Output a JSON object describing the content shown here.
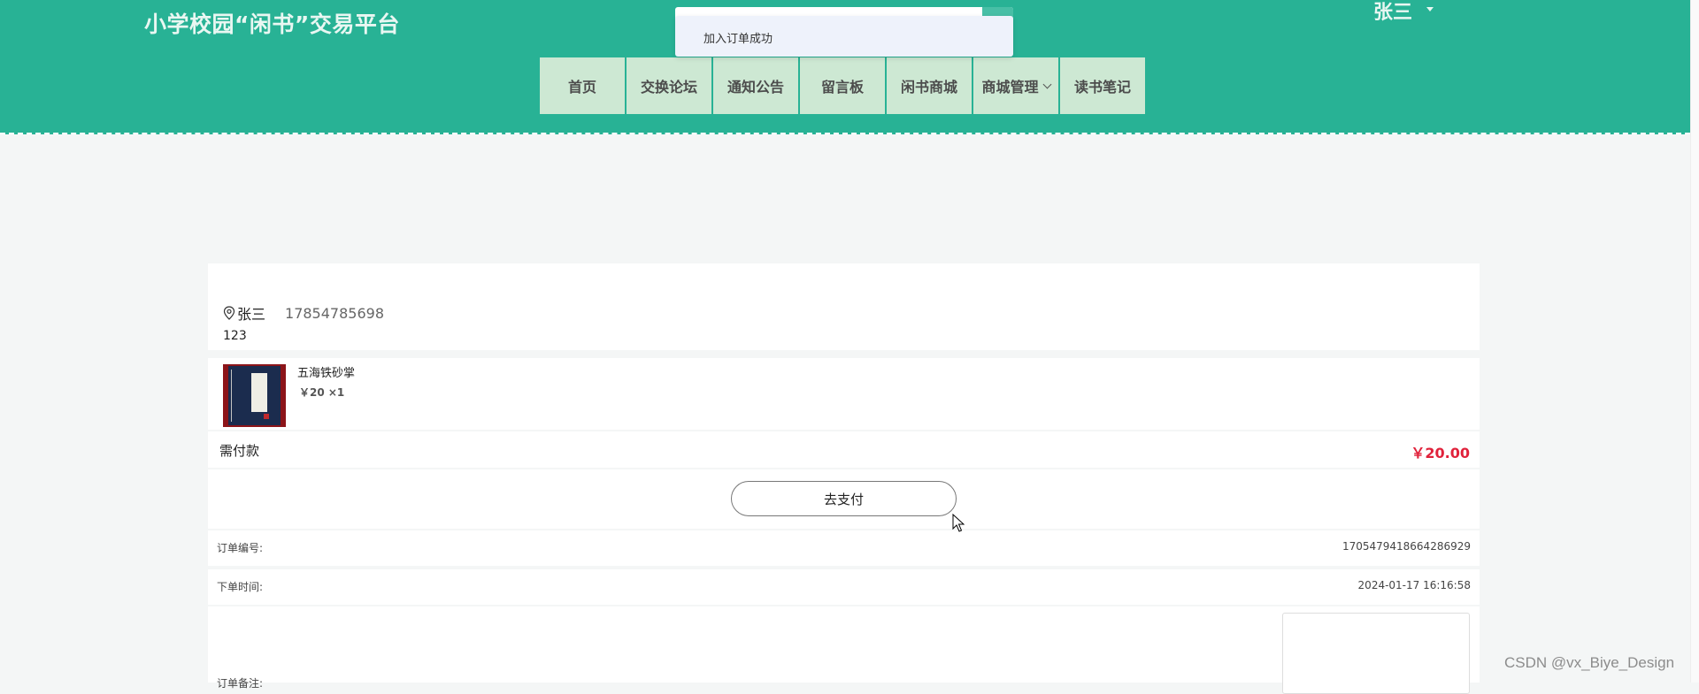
{
  "header": {
    "site_title": "小学校园“闲书”交易平台",
    "user_name": "张三",
    "nav": [
      {
        "label": "首页"
      },
      {
        "label": "交换论坛"
      },
      {
        "label": "通知公告"
      },
      {
        "label": "留言板"
      },
      {
        "label": "闲书商城"
      },
      {
        "label": "商城管理"
      },
      {
        "label": "读书笔记"
      }
    ]
  },
  "toast": {
    "message": "加入订单成功"
  },
  "address": {
    "name": "张三",
    "phone": "17854785698",
    "detail": "123"
  },
  "item": {
    "name": "五海铁砂掌",
    "price_qty": "￥20 ×1"
  },
  "payment": {
    "label": "需付款",
    "amount": "￥20.00",
    "button": "去支付"
  },
  "order": {
    "number_label": "订单编号:",
    "number": "1705479418664286929",
    "time_label": "下单时间:",
    "time": "2024-01-17 16:16:58",
    "remark_label": "订单备注:"
  },
  "watermark": "CSDN @vx_Biye_Design",
  "colors": {
    "header": "#28b295",
    "nav": "#cde8d3",
    "price": "#e0223b"
  }
}
